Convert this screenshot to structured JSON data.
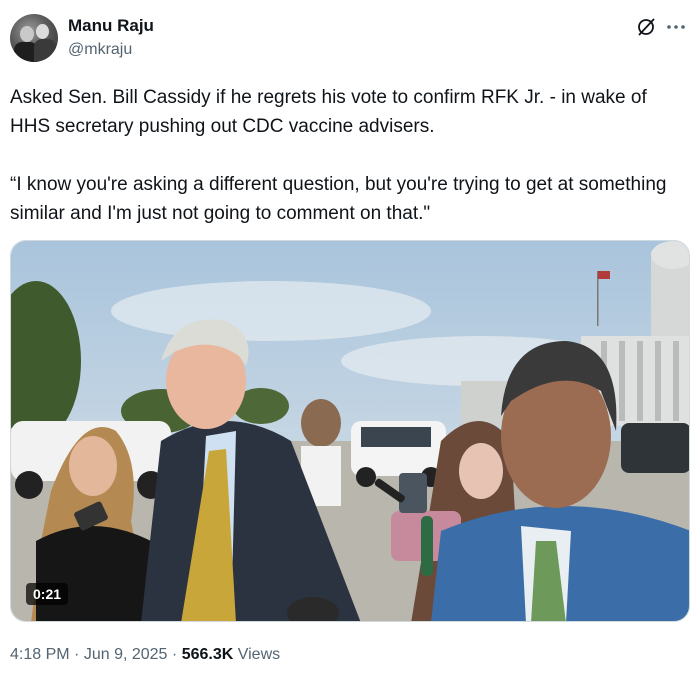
{
  "author": {
    "display_name": "Manu Raju",
    "handle": "@mkraju"
  },
  "tweet": {
    "text": "Asked Sen. Bill Cassidy if he regrets his vote to confirm RFK Jr. - in wake of HHS secretary pushing out CDC vaccine advisers.\n\n“I know you're asking a different question, but you're trying to get at something similar and I'm just not going to comment on that.\""
  },
  "media": {
    "duration": "0:21"
  },
  "meta": {
    "time": "4:18 PM",
    "separator": "·",
    "date": "Jun 9, 2025",
    "views_count": "566.3K",
    "views_label": "Views"
  },
  "icons": {
    "grok": "grok-icon",
    "more": "more-dots-icon"
  },
  "colors": {
    "text": "#0f1419",
    "secondary": "#536471",
    "border": "#cfd9de"
  }
}
